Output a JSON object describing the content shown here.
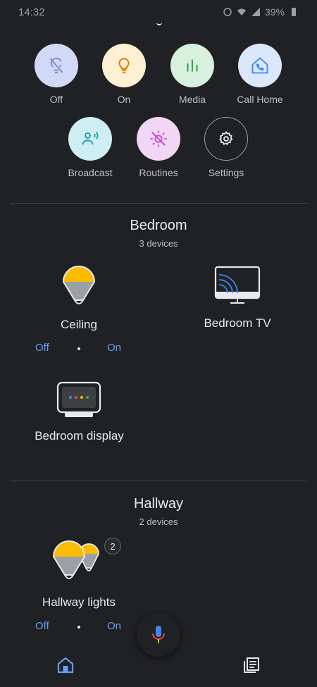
{
  "status": {
    "time": "14:32",
    "battery": "39%"
  },
  "quick_actions": [
    {
      "label": "Off",
      "icon": "lightbulb-off-icon",
      "bg": "#d2d9f7"
    },
    {
      "label": "On",
      "icon": "lightbulb-icon",
      "bg": "#fef1d3"
    },
    {
      "label": "Media",
      "icon": "equalizer-icon",
      "bg": "#d8f0de"
    },
    {
      "label": "Call Home",
      "icon": "call-home-icon",
      "bg": "#dbe8fb"
    },
    {
      "label": "Broadcast",
      "icon": "broadcast-icon",
      "bg": "#cfeef3"
    },
    {
      "label": "Routines",
      "icon": "routines-sun-icon",
      "bg": "#f2d6f5"
    },
    {
      "label": "Settings",
      "icon": "gear-icon",
      "bg": "#202124"
    }
  ],
  "rooms": [
    {
      "name": "Bedroom",
      "count": "3 devices",
      "devices": [
        {
          "name": "Ceiling",
          "icon": "ceiling-light-icon",
          "off": "Off",
          "on": "On"
        },
        {
          "name": "Bedroom TV",
          "icon": "cast-tv-icon"
        },
        {
          "name": "Bedroom display",
          "icon": "smart-display-icon"
        }
      ]
    },
    {
      "name": "Hallway",
      "count": "2 devices",
      "devices": [
        {
          "name": "Hallway lights",
          "icon": "light-group-icon",
          "badge": "2",
          "off": "Off",
          "on": "On"
        }
      ]
    }
  ],
  "nav": {
    "home_icon": "home-icon",
    "feed_icon": "feed-icon",
    "mic_icon": "mic-icon"
  },
  "colors": {
    "accent": "#669df6",
    "background": "#202124",
    "bulb_yellow": "#fbbc04"
  }
}
